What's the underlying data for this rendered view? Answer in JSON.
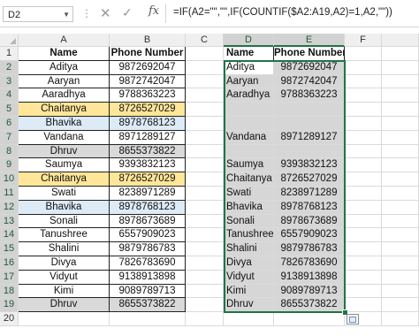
{
  "name_box": "D2",
  "formula": "=IF(A2=\"\",\"\",IF(COUNTIF($A2:A19,A2)=1,A2,\"\"))",
  "fx_label": "fx",
  "columns": [
    "A",
    "B",
    "C",
    "D",
    "E",
    "F"
  ],
  "rows": [
    "1",
    "2",
    "3",
    "4",
    "5",
    "6",
    "7",
    "8",
    "9",
    "10",
    "11",
    "12",
    "13",
    "14",
    "15",
    "16",
    "17",
    "18",
    "19",
    "20"
  ],
  "source_header": {
    "name": "Name",
    "phone": "Phone Number"
  },
  "source": [
    {
      "name": "Aditya",
      "phone": "9872692047",
      "fill": "none"
    },
    {
      "name": "Aaryan",
      "phone": "9872742047",
      "fill": "none"
    },
    {
      "name": "Aaradhya",
      "phone": "9788363223",
      "fill": "none"
    },
    {
      "name": "Chaitanya",
      "phone": "8726527029",
      "fill": "yellow"
    },
    {
      "name": "Bhavika",
      "phone": "8978768123",
      "fill": "blue"
    },
    {
      "name": "Vandana",
      "phone": "8971289127",
      "fill": "none"
    },
    {
      "name": "Dhruv",
      "phone": "8655373822",
      "fill": "grey"
    },
    {
      "name": "Saumya",
      "phone": "9393832123",
      "fill": "none"
    },
    {
      "name": "Chaitanya",
      "phone": "8726527029",
      "fill": "yellow"
    },
    {
      "name": "Swati",
      "phone": "8238971289",
      "fill": "none"
    },
    {
      "name": "Bhavika",
      "phone": "8978768123",
      "fill": "blue"
    },
    {
      "name": "Sonali",
      "phone": "8978673689",
      "fill": "none"
    },
    {
      "name": "Tanushree",
      "phone": "6557909023",
      "fill": "none"
    },
    {
      "name": "Shalini",
      "phone": "9879786783",
      "fill": "none"
    },
    {
      "name": "Divya",
      "phone": "7826783690",
      "fill": "none"
    },
    {
      "name": "Vidyut",
      "phone": "9138913898",
      "fill": "none"
    },
    {
      "name": "Kimi",
      "phone": "9089789713",
      "fill": "none"
    },
    {
      "name": "Dhruv",
      "phone": "8655373822",
      "fill": "grey"
    }
  ],
  "result_header": {
    "name": "Name",
    "phone": "Phone Number"
  },
  "result": [
    {
      "name": "Aditya",
      "phone": "9872692047"
    },
    {
      "name": "Aaryan",
      "phone": "9872742047"
    },
    {
      "name": "Aaradhya",
      "phone": "9788363223"
    },
    {
      "name": "",
      "phone": ""
    },
    {
      "name": "",
      "phone": ""
    },
    {
      "name": "Vandana",
      "phone": "8971289127"
    },
    {
      "name": "",
      "phone": ""
    },
    {
      "name": "Saumya",
      "phone": "9393832123"
    },
    {
      "name": "Chaitanya",
      "phone": "8726527029"
    },
    {
      "name": "Swati",
      "phone": "8238971289"
    },
    {
      "name": "Bhavika",
      "phone": "8978768123"
    },
    {
      "name": "Sonali",
      "phone": "8978673689"
    },
    {
      "name": "Tanushree",
      "phone": "6557909023"
    },
    {
      "name": "Shalini",
      "phone": "9879786783"
    },
    {
      "name": "Divya",
      "phone": "7826783690"
    },
    {
      "name": "Vidyut",
      "phone": "9138913898"
    },
    {
      "name": "Kimi",
      "phone": "9089789713"
    },
    {
      "name": "Dhruv",
      "phone": "8655373822"
    }
  ],
  "colors": {
    "yellow": "#ffe699",
    "blue": "#ddebf7",
    "grey": "#d9d9d9",
    "selection": "#217346"
  }
}
